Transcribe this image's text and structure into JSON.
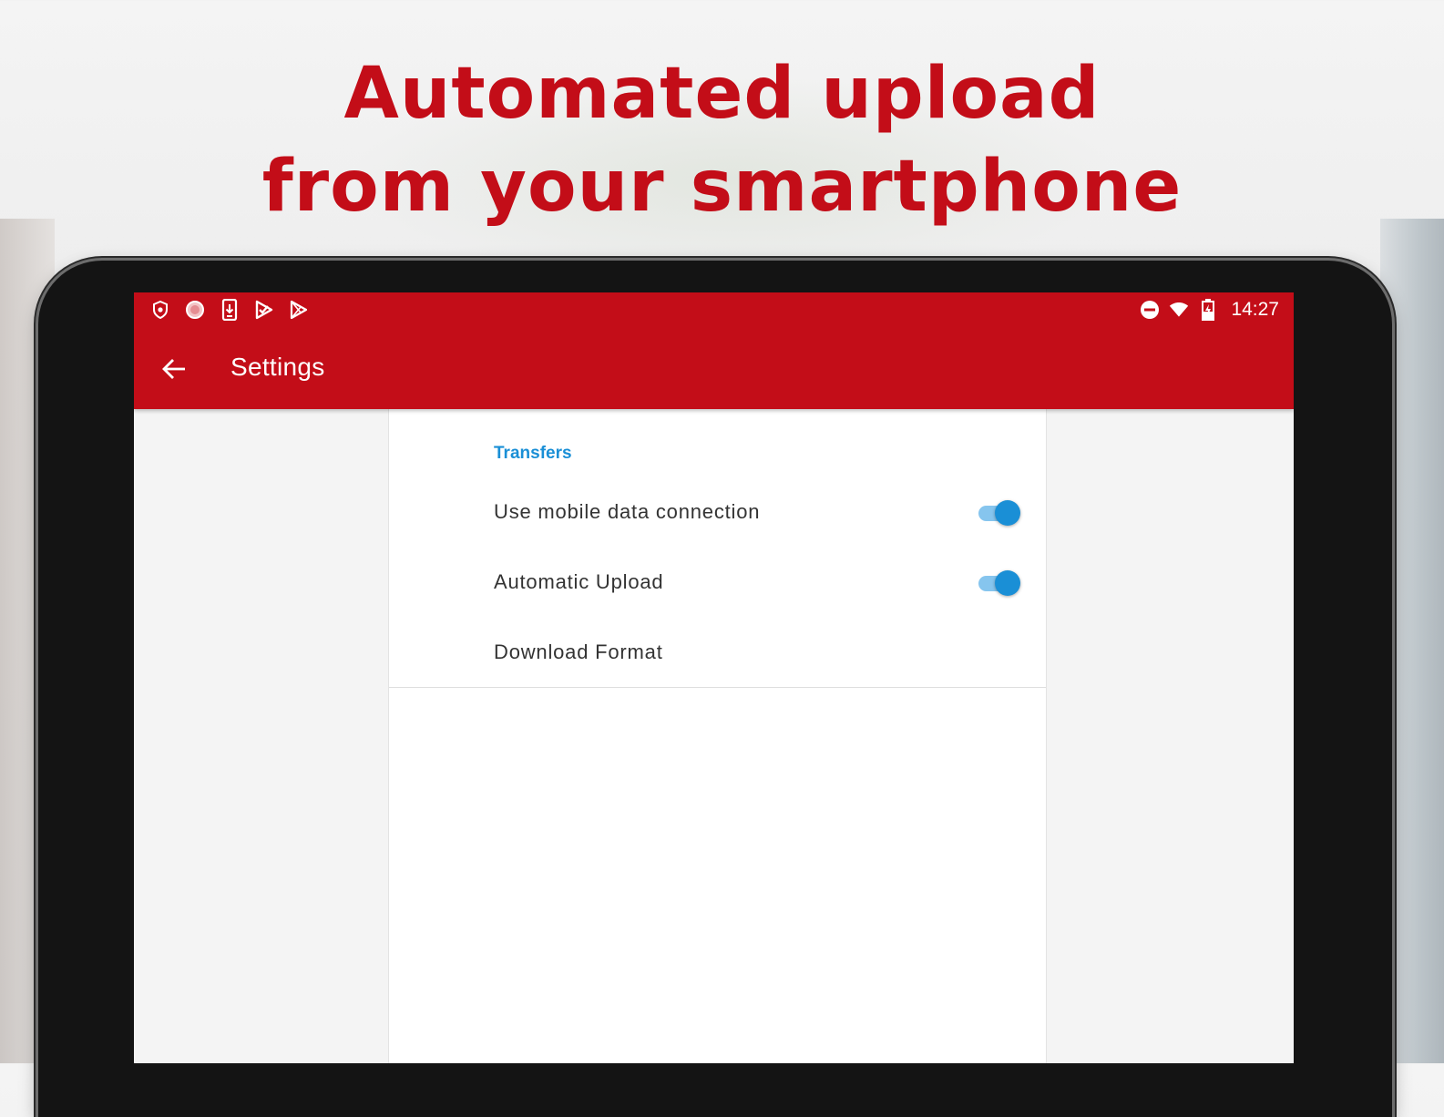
{
  "headline": {
    "line1": "Automated upload",
    "line2": "from your smartphone"
  },
  "status_bar": {
    "left_icons": [
      "shield-icon",
      "record-icon",
      "download-icon",
      "check-flag-icon",
      "play-store-icon"
    ],
    "right_icons": [
      "do-not-disturb-icon",
      "wifi-icon",
      "battery-charging-icon"
    ],
    "time": "14:27"
  },
  "app_bar": {
    "title": "Settings",
    "back_icon": "arrow-left-icon",
    "color": "#c30d18"
  },
  "settings": {
    "section": "Transfers",
    "accent": "#1a8fd6",
    "items": [
      {
        "label": "Use mobile data connection",
        "switch_on": true
      },
      {
        "label": "Automatic Upload",
        "switch_on": true
      },
      {
        "label": "Download Format"
      }
    ]
  }
}
